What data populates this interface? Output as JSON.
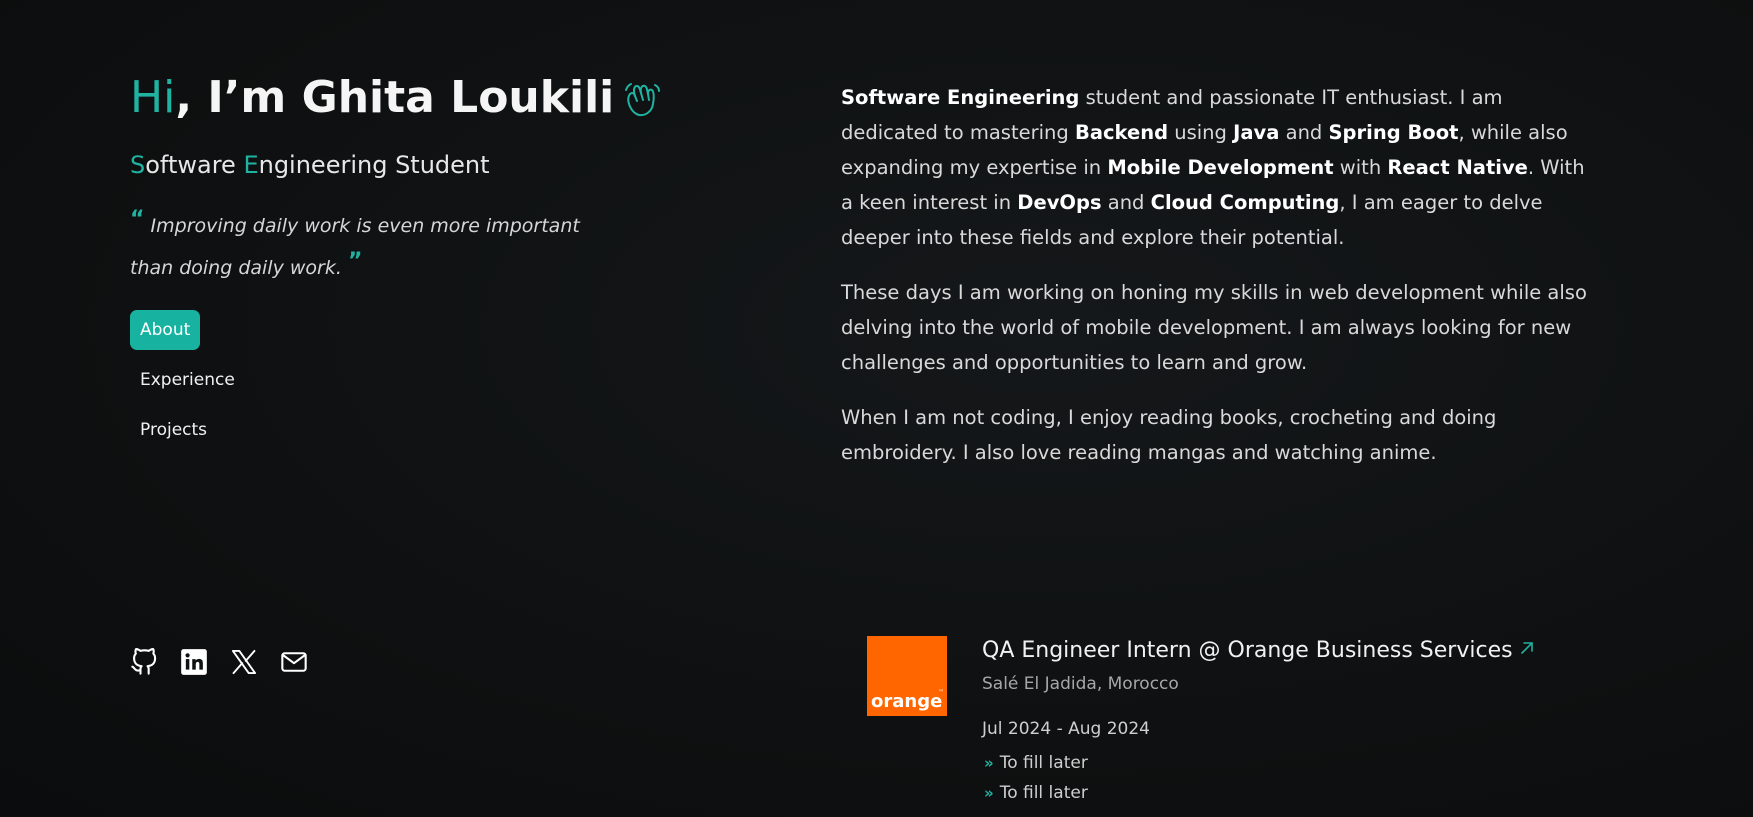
{
  "hero": {
    "greeting": "Hi",
    "rest": ", I’m Ghita Loukili",
    "icon": "waving-hand-icon"
  },
  "subtitle": {
    "s_letter": "S",
    "s_rest": "oftware ",
    "e_letter": "E",
    "e_rest": "ngineering Student"
  },
  "quote": {
    "open": "“",
    "text": "Improving daily work is even more important than doing daily work.",
    "close": "”"
  },
  "nav": {
    "items": [
      {
        "label": "About",
        "active": true
      },
      {
        "label": "Experience",
        "active": false
      },
      {
        "label": "Projects",
        "active": false
      }
    ]
  },
  "socials": [
    {
      "icon": "github-icon"
    },
    {
      "icon": "linkedin-icon"
    },
    {
      "icon": "x-twitter-icon"
    },
    {
      "icon": "mail-icon"
    }
  ],
  "about": {
    "p1": {
      "b1": "Software Engineering",
      "t1": " student and passionate IT enthusiast. I am dedicated to mastering ",
      "b2": "Backend",
      "t2": " using ",
      "b3": "Java",
      "t3": " and ",
      "b4": "Spring Boot",
      "t4": ", while also expanding my expertise in ",
      "b5": "Mobile Development",
      "t5": " with ",
      "b6": "React Native",
      "t6": ". With a keen interest in ",
      "b7": "DevOps",
      "t7": " and ",
      "b8": "Cloud Computing",
      "t8": ", I am eager to delve deeper into these fields and explore their potential."
    },
    "p2": "These days I am working on honing my skills in web development while also delving into the world of mobile development. I am always looking for new challenges and opportunities to learn and grow.",
    "p3": "When I am not coding, I enjoy reading books, crocheting and doing embroidery. I also love reading mangas and watching anime."
  },
  "experience": {
    "logo_text": "orange",
    "logo_tm": "™",
    "logo_color": "#ff6600",
    "title": "QA Engineer Intern @ Orange Business Services",
    "location": "Salé El Jadida, Morocco",
    "date": "Jul 2024 - Aug 2024",
    "bullet_glyph": "»",
    "items": [
      "To fill later",
      "To fill later"
    ]
  },
  "colors": {
    "accent": "#20b3a1",
    "background": "#0f1112"
  }
}
